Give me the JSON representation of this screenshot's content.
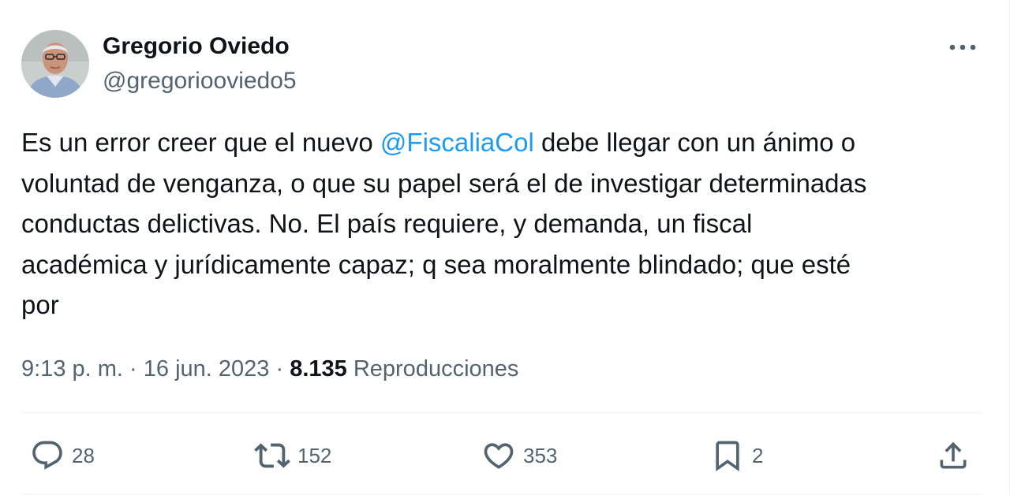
{
  "tweet": {
    "author": {
      "display_name": "Gregorio Oviedo",
      "handle": "@gregoriooviedo5"
    },
    "more_icon": "more-horizontal-icon",
    "text": {
      "before_mention": "Es un error creer que el nuevo ",
      "mention": "@FiscaliaCol",
      "after_mention": " debe llegar con un ánimo o\nvoluntad de venganza, o que su papel será el de investigar determinadas\nconductas delictivas. No. El país requiere, y demanda, un fiscal\nacadémica y jurídicamente capaz; q sea moralmente blindado; que esté\npor"
    },
    "meta": {
      "time": "9:13 p. m.",
      "separator": " · ",
      "date": "16 jun. 2023",
      "views_count": "8.135",
      "views_label": "Reproducciones"
    },
    "actions": {
      "reply": {
        "icon": "reply-icon",
        "count": "28"
      },
      "retweet": {
        "icon": "retweet-icon",
        "count": "152"
      },
      "like": {
        "icon": "heart-icon",
        "count": "353"
      },
      "bookmark": {
        "icon": "bookmark-icon",
        "count": "2"
      },
      "share": {
        "icon": "share-icon"
      }
    },
    "colors": {
      "text_primary": "#0f1419",
      "text_secondary": "#536471",
      "link": "#1d9bf0",
      "divider": "#eff3f4"
    }
  }
}
